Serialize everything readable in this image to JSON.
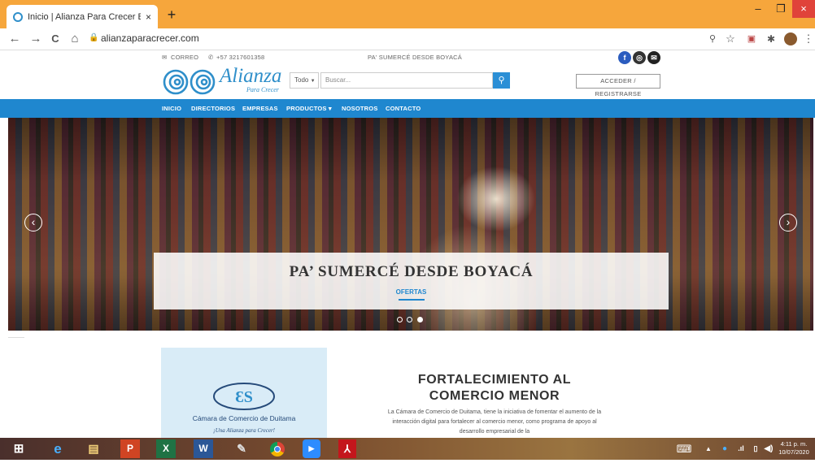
{
  "browser": {
    "tab_title": "Inicio | Alianza Para Crecer Boyac",
    "tab_close": "×",
    "new_tab": "+",
    "url": "alianzaparacrecer.com",
    "back": "←",
    "forward": "→",
    "reload": "C",
    "home": "⌂",
    "win_min": "–",
    "win_max": "❐",
    "win_close": "×"
  },
  "topbar": {
    "email_label": "CORREO",
    "phone": "+57 3217601358",
    "tagline": "PA' SUMERCÉ DESDE BOYACÁ",
    "social": [
      "f",
      "◎",
      "✉"
    ]
  },
  "header": {
    "logo_text": "Alianza",
    "logo_sub": "Para Crecer",
    "search_category": "Todo",
    "search_placeholder": "Buscar...",
    "login_label": "ACCEDER / REGISTRARSE"
  },
  "nav": {
    "items": [
      "INICIO",
      "DIRECTORIOS",
      "EMPRESAS",
      "PRODUCTOS ▾",
      "NOSOTROS",
      "CONTACTO"
    ]
  },
  "hero": {
    "title": "PA’ SUMERCÉ DESDE BOYACÁ",
    "link": "OFERTAS",
    "prev": "‹",
    "next": "›",
    "active_slide": 3,
    "slide_count": 3
  },
  "feature": {
    "card_name": "Cámara de Comercio de Duitama",
    "card_sub": "¡Una Alianza para Crecer!",
    "title": "FORTALECIMIENTO AL COMERCIO MENOR",
    "body": "La Cámara de Comercio de Duitama, tiene la iniciativa de fomentar el aumento de la interacción digital para fortalecer al comercio menor, como programa de apoyo al desarrollo empresarial de la"
  },
  "taskbar": {
    "time": "4:11 p. m.",
    "date": "10/07/2020"
  }
}
